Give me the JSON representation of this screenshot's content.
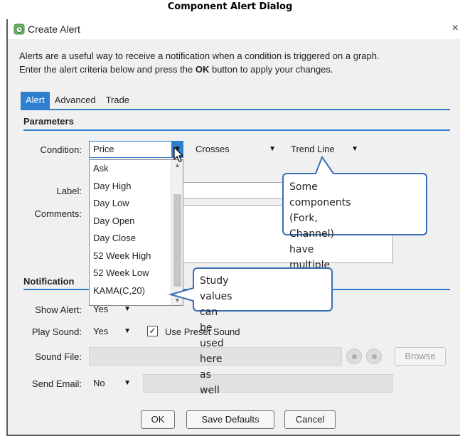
{
  "caption": "Component Alert Dialog",
  "window": {
    "title": "Create Alert",
    "close": "×",
    "icon": "alert-clock-icon"
  },
  "intro": {
    "line1": "Alerts are a useful way to receive a notification when a condition is triggered on a graph.",
    "line2_pre": "Enter the alert criteria below and press the ",
    "line2_bold": "OK",
    "line2_post": " button to apply your changes."
  },
  "tabs": [
    {
      "label": "Alert",
      "active": true
    },
    {
      "label": "Advanced",
      "active": false
    },
    {
      "label": "Trade",
      "active": false
    }
  ],
  "parameters": {
    "heading": "Parameters",
    "condition_label": "Condition:",
    "condition_value": "Price",
    "operator_value": "Crosses",
    "target_value": "Trend Line",
    "label_label": "Label:",
    "comments_label": "Comments:"
  },
  "dropdown_items": [
    "Ask",
    "Day High",
    "Day Low",
    "Day Open",
    "Day Close",
    "52 Week High",
    "52 Week Low",
    "KAMA(C,20)"
  ],
  "notification": {
    "heading": "Notification",
    "show_alert_label": "Show Alert:",
    "show_alert_value": "Yes",
    "play_sound_label": "Play Sound:",
    "play_sound_value": "Yes",
    "use_preset_label": "Use Preset Sound",
    "use_preset_checked": "✓",
    "sound_file_label": "Sound File:",
    "browse_label": "Browse",
    "send_email_label": "Send Email:",
    "send_email_value": "No"
  },
  "buttons": {
    "ok": "OK",
    "save_defaults": "Save Defaults",
    "cancel": "Cancel"
  },
  "callouts": {
    "components_line1": "Some components",
    "components_line2": "(Fork, Channel) have",
    "components_line3": "multiple options here",
    "study_line1": "Study values can be",
    "study_line2": "used here as well"
  },
  "colors": {
    "accent": "#2f7fd0",
    "callout_border": "#3b6fb5"
  }
}
